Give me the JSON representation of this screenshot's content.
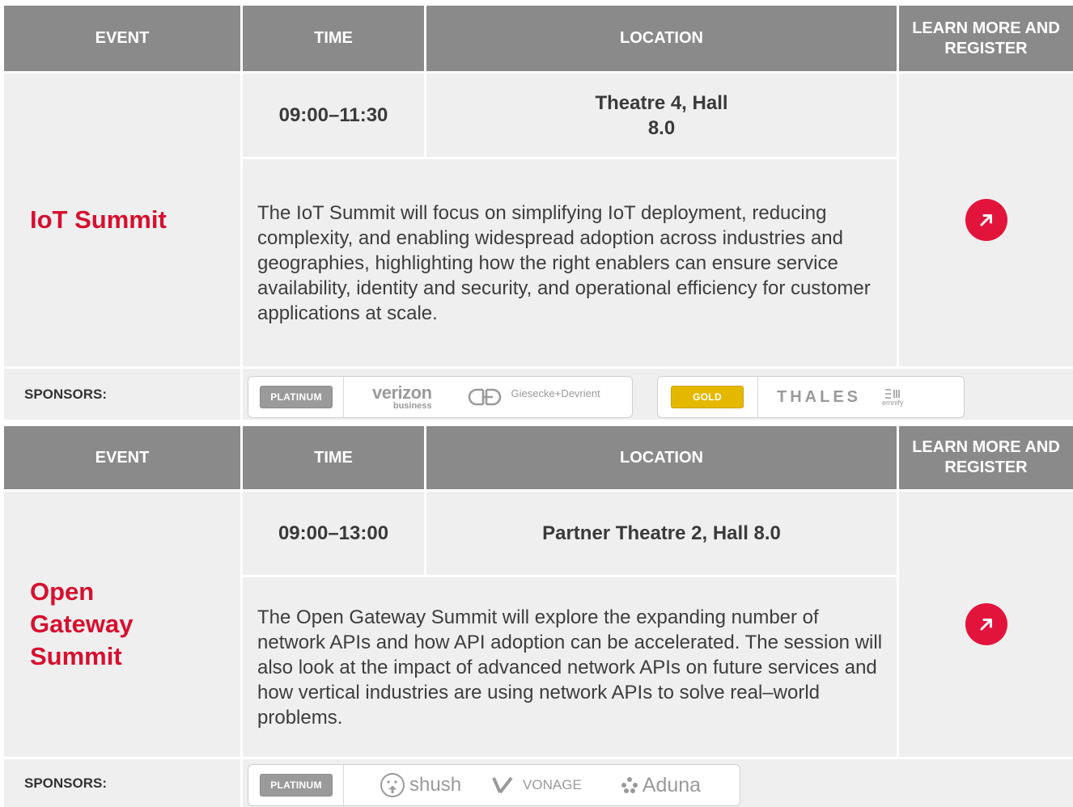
{
  "headers": {
    "event": "EVENT",
    "time": "TIME",
    "location": "LOCATION",
    "learn_more": "LEARN MORE AND REGISTER"
  },
  "events": [
    {
      "name": "IoT Summit",
      "time": "09:00–11:30",
      "location": "Theatre 4, Hall 8.0",
      "description": "The IoT Summit will focus on simplifying IoT deployment, reducing complexity, and enabling widespread adoption across industries and geographies, highlighting how the right enablers can ensure service availability, identity and security, and operational efficiency for customer applications at scale.",
      "link_icon": "arrow-up-right-icon",
      "sponsors_label": "SPONSORS:",
      "sponsor_tiers": [
        {
          "tier": "PLATINUM",
          "sponsors": [
            {
              "name": "verizon",
              "sub": "business"
            },
            {
              "name": "Giesecke+Devrient"
            }
          ]
        },
        {
          "tier": "GOLD",
          "sponsors": [
            {
              "name": "THALES"
            },
            {
              "name": "emnify"
            }
          ]
        }
      ]
    },
    {
      "name": "Open Gateway Summit",
      "time": "09:00–13:00",
      "location": "Partner Theatre 2, Hall 8.0",
      "description": "The Open Gateway Summit will explore the expanding number of network APIs and how API adoption can be accelerated. The session will also look at the impact of advanced network APIs on future services and how vertical industries are using network APIs to solve real–world problems.",
      "link_icon": "arrow-up-right-icon",
      "sponsors_label": "SPONSORS:",
      "sponsor_tiers": [
        {
          "tier": "PLATINUM",
          "sponsors": [
            {
              "name": "shush"
            },
            {
              "name": "VONAGE"
            },
            {
              "name": "Aduna"
            }
          ]
        }
      ]
    }
  ],
  "colors": {
    "header_bg": "#8a8a8a",
    "cell_bg": "#efefef",
    "accent_red": "#d6102f",
    "button_red": "#e3143c",
    "gold": "#e5b800",
    "platinum": "#9a9a9a"
  }
}
